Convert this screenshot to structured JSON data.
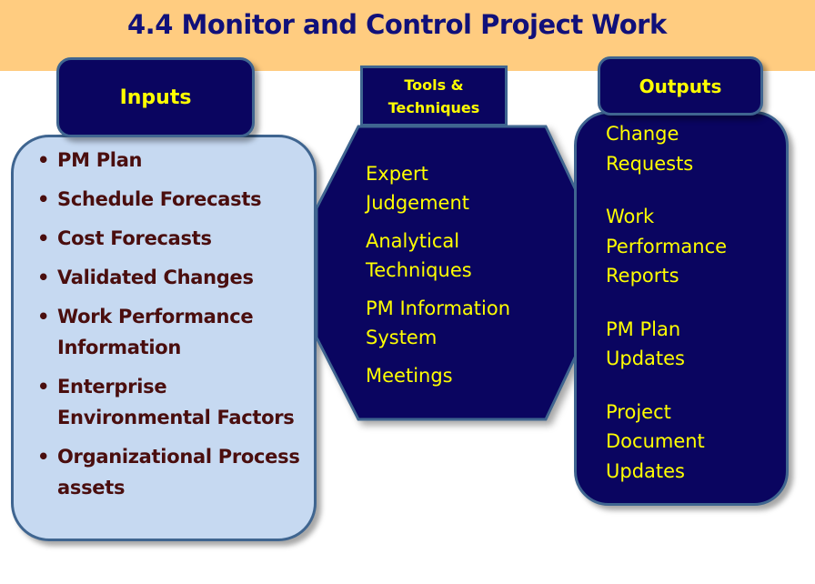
{
  "title": "4.4 Monitor and Control Project Work",
  "inputs": {
    "header": "Inputs",
    "items": [
      "PM Plan",
      "Schedule Forecasts",
      "Cost Forecasts",
      "Validated Changes",
      "Work Performance Information",
      "Enterprise Environmental Factors",
      "Organizational Process assets"
    ]
  },
  "tools": {
    "header_line1": "Tools &",
    "header_line2": "Techniques",
    "items": [
      "Expert\nJudgement",
      "Analytical\nTechniques",
      "PM Information\nSystem",
      "Meetings"
    ]
  },
  "outputs": {
    "header": "Outputs",
    "items": [
      "Change\nRequests",
      "Work\nPerformance\nReports",
      "PM Plan\nUpdates",
      "Project\nDocument\nUpdates"
    ]
  },
  "colors": {
    "banner": "#FFCC80",
    "navy": "#0a0560",
    "text_yellow": "#ffff00",
    "inputs_fill": "#c6d9f1",
    "inputs_text": "#4a0e0e",
    "border": "#3f6590",
    "title": "#10107a"
  }
}
